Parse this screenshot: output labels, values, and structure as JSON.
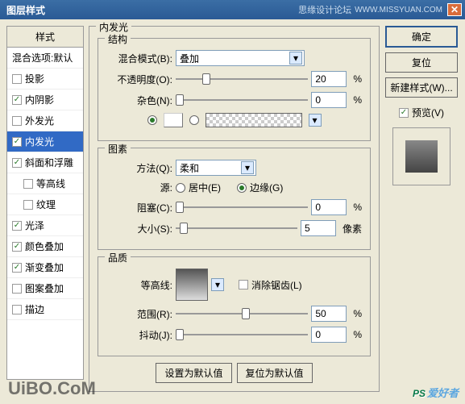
{
  "titlebar": {
    "title": "图层样式",
    "forum": "思缘设计论坛",
    "url": "WWW.MISSYUAN.COM"
  },
  "styles": {
    "header": "样式",
    "blending": "混合选项:默认",
    "items": [
      {
        "label": "投影",
        "checked": false,
        "indent": false
      },
      {
        "label": "内阴影",
        "checked": true,
        "indent": false
      },
      {
        "label": "外发光",
        "checked": false,
        "indent": false
      },
      {
        "label": "内发光",
        "checked": true,
        "indent": false,
        "selected": true
      },
      {
        "label": "斜面和浮雕",
        "checked": true,
        "indent": false
      },
      {
        "label": "等高线",
        "checked": false,
        "indent": true
      },
      {
        "label": "纹理",
        "checked": false,
        "indent": true
      },
      {
        "label": "光泽",
        "checked": true,
        "indent": false
      },
      {
        "label": "颜色叠加",
        "checked": true,
        "indent": false
      },
      {
        "label": "渐变叠加",
        "checked": true,
        "indent": false
      },
      {
        "label": "图案叠加",
        "checked": false,
        "indent": false
      },
      {
        "label": "描边",
        "checked": false,
        "indent": false
      }
    ]
  },
  "panel": {
    "title": "内发光",
    "structure": {
      "title": "结构",
      "blend_label": "混合模式(B):",
      "blend_value": "叠加",
      "opacity_label": "不透明度(O):",
      "opacity_value": "20",
      "opacity_unit": "%",
      "noise_label": "杂色(N):",
      "noise_value": "0",
      "noise_unit": "%"
    },
    "elements": {
      "title": "图素",
      "method_label": "方法(Q):",
      "method_value": "柔和",
      "source_label": "源:",
      "center": "居中(E)",
      "edge": "边缘(G)",
      "choke_label": "阻塞(C):",
      "choke_value": "0",
      "choke_unit": "%",
      "size_label": "大小(S):",
      "size_value": "5",
      "size_unit": "像素"
    },
    "quality": {
      "title": "品质",
      "contour_label": "等高线:",
      "antialias": "消除锯齿(L)",
      "range_label": "范围(R):",
      "range_value": "50",
      "range_unit": "%",
      "jitter_label": "抖动(J):",
      "jitter_value": "0",
      "jitter_unit": "%"
    },
    "defaults": {
      "set": "设置为默认值",
      "reset": "复位为默认值"
    }
  },
  "right": {
    "ok": "确定",
    "cancel": "复位",
    "newstyle": "新建样式(W)...",
    "preview": "预览(V)"
  },
  "watermark": {
    "uibo": "UiBO.CoM",
    "ps": "PS",
    "cn": "爱好者"
  }
}
